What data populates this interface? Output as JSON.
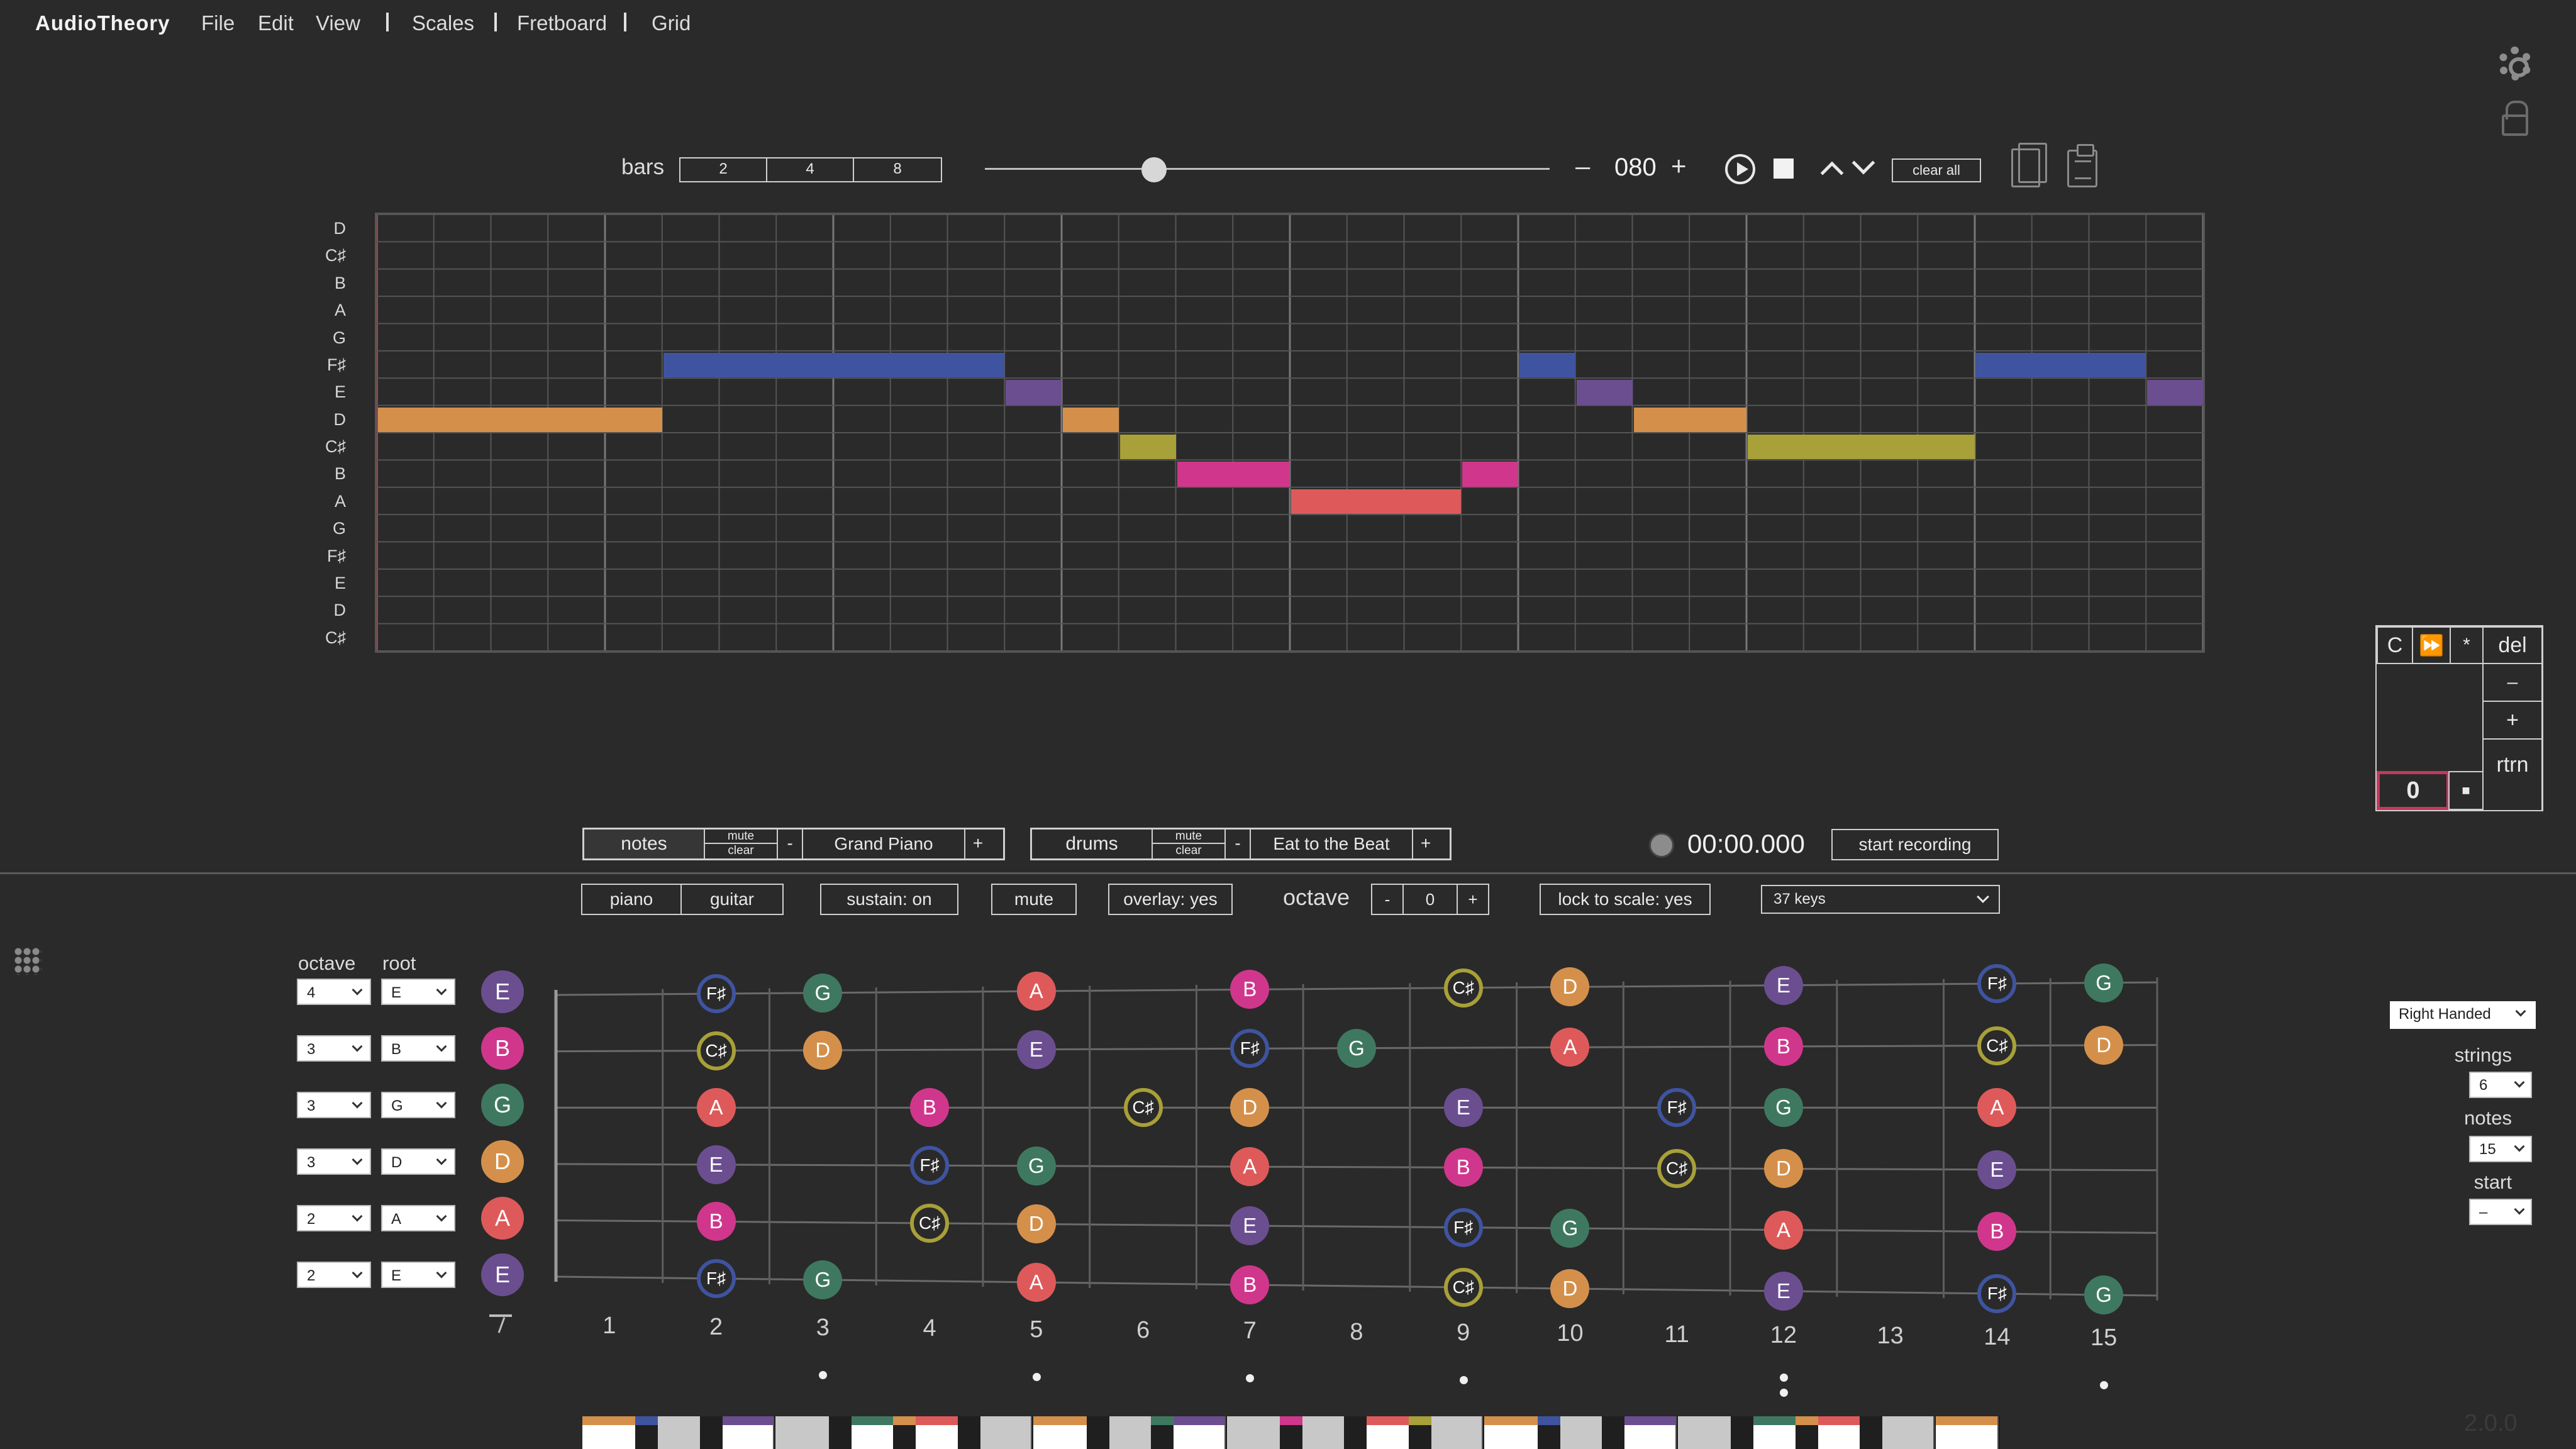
{
  "app": {
    "name": "AudioTheory",
    "menu": [
      "File",
      "Edit",
      "View",
      "Scales",
      "Fretboard",
      "Grid"
    ],
    "version": "2.0.0"
  },
  "transport": {
    "bars_label": "bars",
    "bars_options": [
      "2",
      "4",
      "8"
    ],
    "tempo_minus": "–",
    "tempo": "080",
    "tempo_plus": "+",
    "clear_all": "clear all",
    "tempo_slider_level": 0.3
  },
  "piano_roll": {
    "rows": [
      "D",
      "C♯",
      "B",
      "A",
      "G",
      "F♯",
      "E",
      "D",
      "C♯",
      "B",
      "A",
      "G",
      "F♯",
      "E",
      "D",
      "C♯"
    ],
    "columns": 32,
    "note_colors": {
      "D": "#D4904A",
      "E": "#6B4E90",
      "F♯": "#3F54A0",
      "G": "#3F7860",
      "A": "#DE5A5A",
      "B": "#D0378C",
      "C♯": "#A8A038"
    },
    "notes": [
      {
        "pitch": "D",
        "row": 7,
        "start": 0,
        "length": 5
      },
      {
        "pitch": "F♯",
        "row": 5,
        "start": 5,
        "length": 6
      },
      {
        "pitch": "E",
        "row": 6,
        "start": 11,
        "length": 1
      },
      {
        "pitch": "D",
        "row": 7,
        "start": 12,
        "length": 1
      },
      {
        "pitch": "C♯",
        "row": 8,
        "start": 13,
        "length": 1
      },
      {
        "pitch": "B",
        "row": 9,
        "start": 14,
        "length": 2
      },
      {
        "pitch": "A",
        "row": 10,
        "start": 16,
        "length": 3
      },
      {
        "pitch": "B",
        "row": 9,
        "start": 19,
        "length": 1
      },
      {
        "pitch": "F♯",
        "row": 5,
        "start": 20,
        "length": 1
      },
      {
        "pitch": "E",
        "row": 6,
        "start": 21,
        "length": 1
      },
      {
        "pitch": "D",
        "row": 7,
        "start": 22,
        "length": 2
      },
      {
        "pitch": "C♯",
        "row": 8,
        "start": 24,
        "length": 4
      },
      {
        "pitch": "F♯",
        "row": 5,
        "start": 28,
        "length": 3
      },
      {
        "pitch": "E",
        "row": 6,
        "start": 31,
        "length": 1
      }
    ]
  },
  "side_panel": {
    "c": "C",
    "ff": "⏩",
    "star": "*",
    "del": "del",
    "minus": "–",
    "plus": "+",
    "rtrn": "rtrn",
    "value": "0",
    "stop": "■"
  },
  "tracks": {
    "notes": {
      "name": "notes",
      "mute": "mute",
      "clear": "clear",
      "minus": "-",
      "instrument": "Grand Piano",
      "plus": "+"
    },
    "drums": {
      "name": "drums",
      "mute": "mute",
      "clear": "clear",
      "minus": "-",
      "instrument": "Eat to the Beat",
      "plus": "+"
    }
  },
  "recording": {
    "timer": "00:00.000",
    "start": "start recording"
  },
  "controls": {
    "piano": "piano",
    "guitar": "guitar",
    "sustain": "sustain: on",
    "mute": "mute",
    "overlay": "overlay: yes",
    "octave_label": "octave",
    "octave_minus": "-",
    "octave_value": "0",
    "octave_plus": "+",
    "lock": "lock to scale: yes",
    "keys": "37 keys"
  },
  "tuning": {
    "octave_header": "octave",
    "root_header": "root",
    "strings": [
      {
        "octave": "4",
        "root": "E",
        "color": "#6B4E90"
      },
      {
        "octave": "3",
        "root": "B",
        "color": "#D0378C"
      },
      {
        "octave": "3",
        "root": "G",
        "color": "#3F7860"
      },
      {
        "octave": "3",
        "root": "D",
        "color": "#D4904A"
      },
      {
        "octave": "2",
        "root": "A",
        "color": "#DE5A5A"
      },
      {
        "octave": "2",
        "root": "E",
        "color": "#6B4E90"
      }
    ]
  },
  "fretboard": {
    "frets": [
      "1",
      "2",
      "3",
      "4",
      "5",
      "6",
      "7",
      "8",
      "9",
      "10",
      "11",
      "12",
      "13",
      "14",
      "15"
    ],
    "inlay_frets": [
      3,
      5,
      7,
      9,
      12,
      15
    ],
    "double_inlay_frets": [
      12
    ],
    "notes": [
      {
        "string": 0,
        "fret": 2,
        "n": "F♯"
      },
      {
        "string": 0,
        "fret": 3,
        "n": "G"
      },
      {
        "string": 0,
        "fret": 5,
        "n": "A"
      },
      {
        "string": 0,
        "fret": 7,
        "n": "B"
      },
      {
        "string": 0,
        "fret": 9,
        "n": "C♯"
      },
      {
        "string": 0,
        "fret": 10,
        "n": "D"
      },
      {
        "string": 0,
        "fret": 12,
        "n": "E"
      },
      {
        "string": 0,
        "fret": 14,
        "n": "F♯"
      },
      {
        "string": 0,
        "fret": 15,
        "n": "G"
      },
      {
        "string": 1,
        "fret": 2,
        "n": "C♯"
      },
      {
        "string": 1,
        "fret": 3,
        "n": "D"
      },
      {
        "string": 1,
        "fret": 5,
        "n": "E"
      },
      {
        "string": 1,
        "fret": 7,
        "n": "F♯"
      },
      {
        "string": 1,
        "fret": 8,
        "n": "G"
      },
      {
        "string": 1,
        "fret": 10,
        "n": "A"
      },
      {
        "string": 1,
        "fret": 12,
        "n": "B"
      },
      {
        "string": 1,
        "fret": 14,
        "n": "C♯"
      },
      {
        "string": 1,
        "fret": 15,
        "n": "D"
      },
      {
        "string": 2,
        "fret": 2,
        "n": "A"
      },
      {
        "string": 2,
        "fret": 4,
        "n": "B"
      },
      {
        "string": 2,
        "fret": 6,
        "n": "C♯"
      },
      {
        "string": 2,
        "fret": 7,
        "n": "D"
      },
      {
        "string": 2,
        "fret": 9,
        "n": "E"
      },
      {
        "string": 2,
        "fret": 11,
        "n": "F♯"
      },
      {
        "string": 2,
        "fret": 12,
        "n": "G"
      },
      {
        "string": 2,
        "fret": 14,
        "n": "A"
      },
      {
        "string": 3,
        "fret": 2,
        "n": "E"
      },
      {
        "string": 3,
        "fret": 4,
        "n": "F♯"
      },
      {
        "string": 3,
        "fret": 5,
        "n": "G"
      },
      {
        "string": 3,
        "fret": 7,
        "n": "A"
      },
      {
        "string": 3,
        "fret": 9,
        "n": "B"
      },
      {
        "string": 3,
        "fret": 11,
        "n": "C♯"
      },
      {
        "string": 3,
        "fret": 12,
        "n": "D"
      },
      {
        "string": 3,
        "fret": 14,
        "n": "E"
      },
      {
        "string": 4,
        "fret": 2,
        "n": "B"
      },
      {
        "string": 4,
        "fret": 4,
        "n": "C♯"
      },
      {
        "string": 4,
        "fret": 5,
        "n": "D"
      },
      {
        "string": 4,
        "fret": 7,
        "n": "E"
      },
      {
        "string": 4,
        "fret": 9,
        "n": "F♯"
      },
      {
        "string": 4,
        "fret": 10,
        "n": "G"
      },
      {
        "string": 4,
        "fret": 12,
        "n": "A"
      },
      {
        "string": 4,
        "fret": 14,
        "n": "B"
      },
      {
        "string": 5,
        "fret": 2,
        "n": "F♯"
      },
      {
        "string": 5,
        "fret": 3,
        "n": "G"
      },
      {
        "string": 5,
        "fret": 5,
        "n": "A"
      },
      {
        "string": 5,
        "fret": 7,
        "n": "B"
      },
      {
        "string": 5,
        "fret": 9,
        "n": "C♯"
      },
      {
        "string": 5,
        "fret": 10,
        "n": "D"
      },
      {
        "string": 5,
        "fret": 12,
        "n": "E"
      },
      {
        "string": 5,
        "fret": 14,
        "n": "F♯"
      },
      {
        "string": 5,
        "fret": 15,
        "n": "G"
      }
    ]
  },
  "options": {
    "handed": "Right Handed",
    "strings_label": "strings",
    "strings_value": "6",
    "notes_label": "notes",
    "notes_value": "15",
    "start_label": "start",
    "start_value": "–"
  },
  "keyboard": {
    "keys": 22,
    "highlighted_keys": [
      1,
      3,
      5,
      6,
      8,
      10,
      13,
      15,
      17,
      19,
      20,
      22
    ]
  }
}
